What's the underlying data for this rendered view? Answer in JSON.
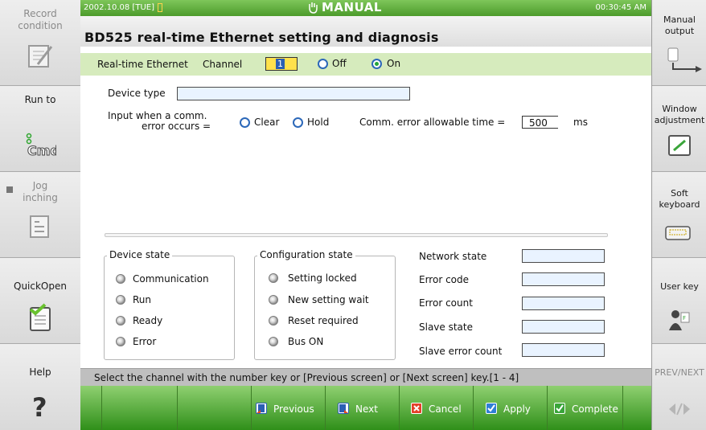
{
  "top_bar": {
    "date": "2002.10.08 [TUE]",
    "mode": "MANUAL",
    "time": "00:30:45 AM"
  },
  "left_panel": [
    {
      "label": "Record\ncondition",
      "icon": "record-icon",
      "enabled": false
    },
    {
      "label": "Run to",
      "icon": "cmd-icon",
      "enabled": true
    },
    {
      "label": "Jog\ninching",
      "icon": "jog-icon",
      "enabled": false
    },
    {
      "label": "QuickOpen",
      "icon": "document-icon",
      "enabled": true
    },
    {
      "label": "Help",
      "icon": "question-icon",
      "enabled": true
    }
  ],
  "right_panel": [
    {
      "label": "Manual\noutput",
      "icon": "hand-icon",
      "enabled": true
    },
    {
      "label": "Window\nadjustment",
      "icon": "window-icon",
      "enabled": true
    },
    {
      "label": "Soft\nkeyboard",
      "icon": "keyboard-icon",
      "enabled": true
    },
    {
      "label": "User key",
      "icon": "user-icon",
      "enabled": true
    },
    {
      "label": "PREV/NEXT",
      "icon": "prev-next-icon",
      "enabled": false
    }
  ],
  "title": "BD525 real-time Ethernet setting and diagnosis",
  "channel_row": {
    "label": "Real-time Ethernet",
    "channel_label": "Channel",
    "channel_value": "1",
    "off_label": "Off",
    "on_label": "On",
    "selected": "On"
  },
  "device_type": {
    "label": "Device type",
    "value": ""
  },
  "comm_error": {
    "label_line1": "Input when a comm.",
    "label_line2": "error occurs  =",
    "clear_label": "Clear",
    "hold_label": "Hold",
    "allowable_label": "Comm. error allowable time =",
    "allowable_value": "500",
    "unit": "ms"
  },
  "device_state": {
    "title": "Device state",
    "items": [
      "Communication",
      "Run",
      "Ready",
      "Error"
    ]
  },
  "configuration_state": {
    "title": "Configuration state",
    "items": [
      "Setting locked",
      "New setting wait",
      "Reset required",
      "Bus ON"
    ]
  },
  "network": {
    "labels": [
      "Network state",
      "Error code",
      "Error count",
      "Slave state",
      "Slave error count"
    ],
    "values": [
      "",
      "",
      "",
      "",
      ""
    ]
  },
  "status_text": "Select the channel with the number key or [Previous screen] or [Next screen] key.[1 - 4]",
  "bottom_buttons": [
    {
      "label": "",
      "icon": ""
    },
    {
      "label": "",
      "icon": ""
    },
    {
      "label": "",
      "icon": ""
    },
    {
      "label": "Previous",
      "icon": "previous-icon"
    },
    {
      "label": "Next",
      "icon": "next-icon"
    },
    {
      "label": "Cancel",
      "icon": "cancel-icon"
    },
    {
      "label": "Apply",
      "icon": "apply-icon"
    },
    {
      "label": "Complete",
      "icon": "complete-icon"
    }
  ],
  "colors": {
    "green_bar": "#4c9b2b",
    "channel_row": "#d6ebbd",
    "radio": "#2c68b9",
    "field": "#e9f3ff"
  }
}
